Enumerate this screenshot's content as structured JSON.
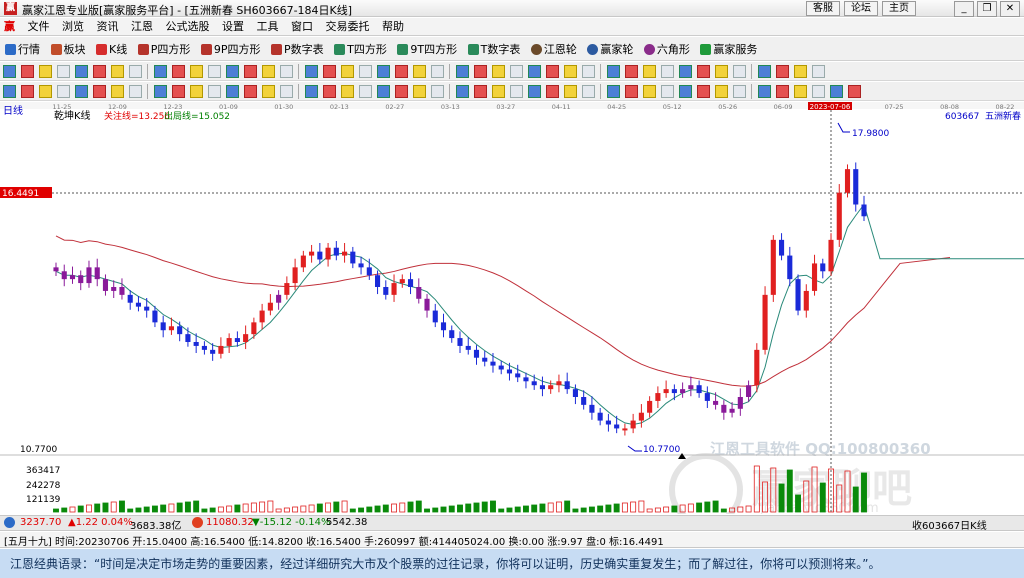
{
  "window": {
    "title": "赢家江恩专业版[赢家服务平台] - [五洲新春  SH603667-184日K线]",
    "links": [
      "客服",
      "论坛",
      "主页"
    ]
  },
  "menu": [
    "文件",
    "浏览",
    "资讯",
    "江恩",
    "公式选股",
    "设置",
    "工具",
    "窗口",
    "交易委托",
    "帮助"
  ],
  "toolbar": [
    "行情",
    "板块",
    "K线",
    "P四方形",
    "9P四方形",
    "P数字表",
    "T四方形",
    "9T四方形",
    "T数字表",
    "江恩轮",
    "赢家轮",
    "六角形",
    "赢家服务"
  ],
  "chart_header": {
    "period_label": "日线",
    "indicator_name": "乾坤K线",
    "focus_line": "关注线=13.256",
    "exit_line": "出局线=15.052",
    "stock_code": "603667",
    "stock_name": "五洲新春",
    "high_price_label": "17.9800",
    "low_price_label": "10.7700",
    "crosshair_price": "16.4491",
    "crosshair_date": "2023-07-06"
  },
  "watermark": {
    "line1": "江恩工具软件  QQ:100800360",
    "line2": "赢家聊吧",
    "url": "jiaoba.vic360.com"
  },
  "chart_data": {
    "type": "candlestick",
    "x_dates": [
      "11-25",
      "12-09",
      "12-23",
      "01-09",
      "01-30",
      "02-13",
      "02-27",
      "03-13",
      "03-27",
      "04-11",
      "04-25",
      "05-12",
      "05-26",
      "06-09",
      "06-27",
      "07-25",
      "08-08",
      "08-22"
    ],
    "y_price_label": "10.7700",
    "volume_ticks": [
      "363417",
      "242278",
      "121139"
    ],
    "price_high": 17.98,
    "price_low": 10.77,
    "price_crosshair": 16.4491,
    "candle_closes": [
      14.8,
      14.6,
      14.7,
      14.5,
      14.9,
      14.6,
      14.3,
      14.4,
      14.2,
      14.0,
      13.9,
      13.8,
      13.5,
      13.3,
      13.4,
      13.2,
      13.0,
      12.9,
      12.8,
      12.7,
      12.9,
      13.1,
      13.0,
      13.2,
      13.5,
      13.8,
      14.0,
      14.2,
      14.5,
      14.9,
      15.2,
      15.3,
      15.1,
      15.4,
      15.2,
      15.3,
      15.0,
      14.9,
      14.7,
      14.4,
      14.2,
      14.5,
      14.6,
      14.4,
      14.1,
      13.8,
      13.5,
      13.3,
      13.1,
      12.9,
      12.8,
      12.6,
      12.5,
      12.4,
      12.3,
      12.2,
      12.1,
      12.0,
      11.9,
      11.8,
      11.9,
      12.0,
      11.8,
      11.6,
      11.4,
      11.2,
      11.0,
      10.9,
      10.8,
      10.8,
      11.0,
      11.2,
      11.5,
      11.7,
      11.8,
      11.7,
      11.8,
      11.9,
      11.7,
      11.5,
      11.4,
      11.2,
      11.3,
      11.6,
      11.9,
      12.8,
      14.2,
      15.6,
      15.2,
      14.6,
      13.8,
      14.3,
      15.0,
      14.8,
      15.6,
      16.8,
      17.4,
      16.5,
      16.2
    ]
  },
  "status": {
    "index1_val": "3237.70",
    "index1_chg": "▲1.22 0.04%",
    "index1_amt": "3683.38亿",
    "index2_val": "11080.32",
    "index2_chg": "▼-15.12 -0.14%",
    "index2_amt": "5542.38",
    "right_text": "收603667日K线"
  },
  "info_line": "[五月十九] 时间:20230706 开:15.0400 高:16.5400 低:14.8200 收:16.5400 手:260997 额:414405024.00 换:0.00 涨:9.97 盘:0 标:16.4491",
  "quote": "江恩经典语录：“时间是决定市场走势的重要因素，经过详细研究大市及个股票的过往记录，你将可以证明，历史确实重复发生；而了解过往，你将可以预测将来。”。"
}
